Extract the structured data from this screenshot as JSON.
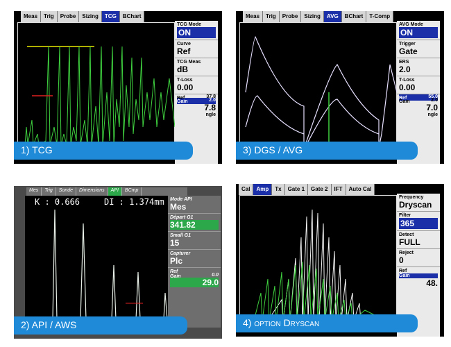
{
  "panels": {
    "tcg": {
      "caption": "1) TCG",
      "tabs": [
        "Meas",
        "Trig",
        "Probe",
        "Sizing",
        "TCG",
        "BChart"
      ],
      "active_tab": "TCG",
      "side": [
        {
          "label": "TCG Mode",
          "value": "ON",
          "inv": true
        },
        {
          "label": "Curve",
          "value": "Ref"
        },
        {
          "label": "TCG Meas",
          "value": "dB"
        },
        {
          "label": "T-Loss",
          "value": "0.00"
        }
      ],
      "footer": {
        "ref_label": "Ref",
        "ref_val": "37.8",
        "gain_label": "Gain",
        "gain_val": "2.0",
        "big": "7.8",
        "tail": "ngle"
      }
    },
    "dgs": {
      "caption": "3) DGS / AVG",
      "tabs": [
        "Meas",
        "Trig",
        "Probe",
        "Sizing",
        "AVG",
        "BChart",
        "T-Comp"
      ],
      "active_tab": "AVG",
      "side": [
        {
          "label": "AVG Mode",
          "value": "ON",
          "inv": true
        },
        {
          "label": "Trigger",
          "value": "Gate"
        },
        {
          "label": "ERS",
          "value": "2.0"
        },
        {
          "label": "T-Loss",
          "value": "0.00"
        }
      ],
      "footer": {
        "ref_label": "Ref",
        "ref_val": "55.0",
        "gain_label": "Gain",
        "gain_val": "2.0",
        "big": "7.0",
        "tail": "ngle"
      }
    },
    "api": {
      "caption": "2) API / AWS",
      "tabs": [
        "Mes",
        "Trig",
        "Sonde",
        "Dimensions",
        "API",
        "BCmp"
      ],
      "active_tab": "API",
      "readout_k": "K : 0.666",
      "readout_di": "DI : 1.374mm",
      "side": [
        {
          "label": "Mode API",
          "value": "Mes"
        },
        {
          "label": "Départ G1",
          "value": "341.82",
          "grn": true
        },
        {
          "label": "Small G1",
          "value": "15"
        },
        {
          "label": "Capturer",
          "value": "Plc"
        }
      ],
      "footer": {
        "ref_label": "Ref",
        "gain_label": "Gain",
        "gain_val": "0.0",
        "big": "29.0"
      }
    },
    "dryscan": {
      "caption": "4) option Dryscan",
      "tabs": [
        "Cal",
        "Amp",
        "Tx",
        "Gate 1",
        "Gate 2",
        "IFT",
        "Auto Cal"
      ],
      "active_tab": "Amp",
      "side": [
        {
          "label": "Frequency",
          "value": "Dryscan"
        },
        {
          "label": "Filter",
          "value": "365",
          "inv": true
        },
        {
          "label": "Detect",
          "value": "FULL"
        },
        {
          "label": "Reject",
          "value": "0"
        }
      ],
      "footer": {
        "ref_label": "Ref",
        "gain_label": "Gain",
        "big": "48."
      }
    }
  },
  "colors": {
    "accent": "#1f8ad8",
    "active_tab": "#1a2fa8",
    "trace": "#3fd13f",
    "api_green": "#2ca84a"
  }
}
